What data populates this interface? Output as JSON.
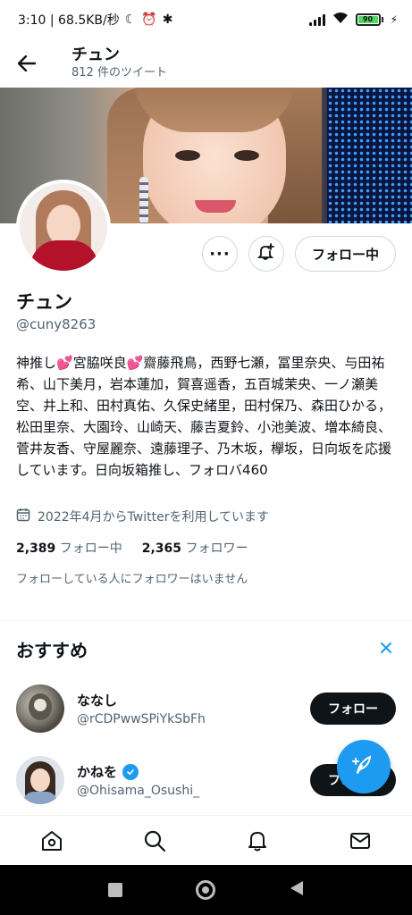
{
  "status_bar": {
    "time_speed": "3:10 | 68.5KB/秒",
    "battery": "90"
  },
  "header": {
    "name": "チュン",
    "tweet_count": "812 件のツイート"
  },
  "profile": {
    "name": "チュン",
    "handle": "@cuny8263",
    "following_button": "フォロー中",
    "bio_part1": "神推し",
    "bio_part2": "宮脇咲良",
    "bio_part3": "齋藤飛鳥，西野七瀬，冨里奈央、与田祐希、山下美月，岩本蓮加，賀喜遥香，五百城茉央、一ノ瀬美空、井上和、田村真佑、久保史緒里，田村保乃、森田ひかる，松田里奈、大園玲、山崎天、藤吉夏鈴、小池美波、増本綺良、菅井友香、守屋麗奈、遠藤理子、乃木坂，欅坂，日向坂を応援しています。日向坂箱推し、フォロバ460",
    "joined": "2022年4月からTwitterを利用しています",
    "following_count": "2,389",
    "following_label": "フォロー中",
    "followers_count": "2,365",
    "followers_label": "フォロワー",
    "followers_note": "フォローしている人にフォロワーはいません"
  },
  "recommendations": {
    "title": "おすすめ",
    "items": [
      {
        "name": "ななし",
        "handle": "@rCDPwwSPiYkSbFh",
        "button": "フォロー"
      },
      {
        "name": "かねを",
        "handle": "@Ohisama_Osushi_",
        "button": "フォロー"
      }
    ]
  },
  "icons": {
    "back": "back-arrow-icon",
    "more": "more-icon",
    "notify": "bell-plus-icon",
    "calendar": "calendar-icon",
    "close": "close-icon",
    "compose": "compose-icon",
    "home": "home-icon",
    "search": "search-icon",
    "notifications": "bell-icon",
    "messages": "mail-icon"
  },
  "colors": {
    "accent": "#1d9bf0",
    "text": "#0f1419",
    "secondary": "#536471",
    "heart": "#d8334a"
  }
}
